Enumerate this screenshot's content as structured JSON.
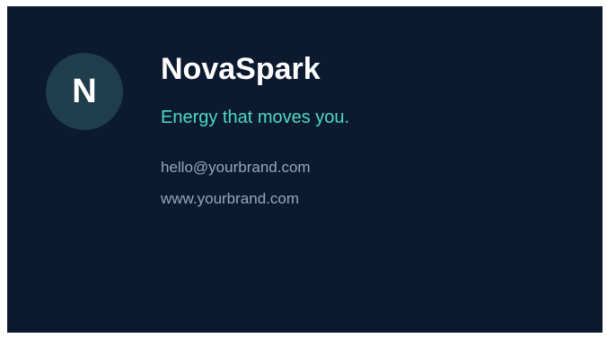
{
  "card": {
    "avatar_letter": "N",
    "brand_name": "NovaSpark",
    "tagline": "Energy that moves you.",
    "email": "hello@yourbrand.com",
    "website": "www.yourbrand.com"
  },
  "colors": {
    "background": "#0c1a30",
    "avatar": "#1f3d4d",
    "accent": "#4fd8c4",
    "muted_text": "#9aa6b6"
  }
}
